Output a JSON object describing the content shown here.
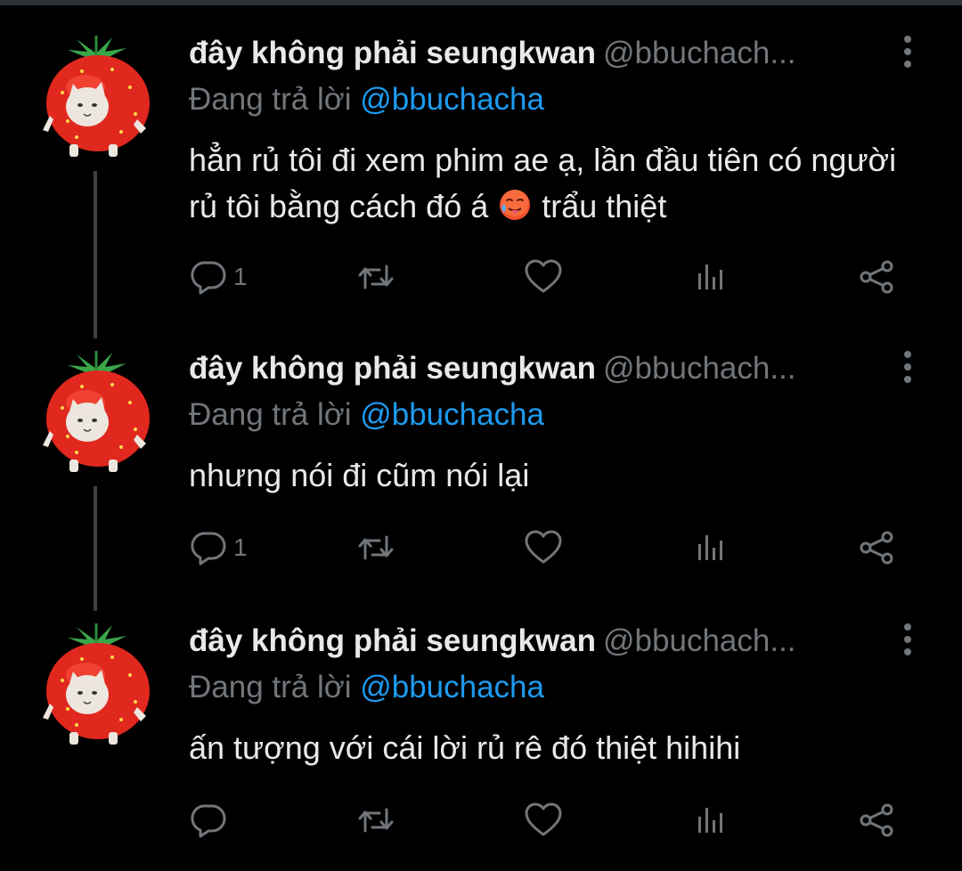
{
  "tweets": [
    {
      "author_name": "đây không phải seungkwan",
      "author_handle": "@bbuchach...",
      "replying_prefix": "Đang trả lời ",
      "replying_to": "@bbuchacha",
      "text_before_emoji": "hẳn rủ tôi đi xem phim ae ạ, lần đầu tiên có người rủ tôi bằng cách đó á ",
      "emoji": "hot-face-emoji",
      "text_after_emoji": " trẩu thiệt",
      "reply_count": "1"
    },
    {
      "author_name": "đây không phải seungkwan",
      "author_handle": "@bbuchach...",
      "replying_prefix": "Đang trả lời ",
      "replying_to": "@bbuchacha",
      "text": "nhưng nói đi cũm nói lại",
      "reply_count": "1"
    },
    {
      "author_name": "đây không phải seungkwan",
      "author_handle": "@bbuchach...",
      "replying_prefix": "Đang trả lời ",
      "replying_to": "@bbuchacha",
      "text": "ấn tượng với cái lời rủ rê đó thiệt hihihi",
      "reply_count": ""
    }
  ],
  "icons": {
    "reply": "reply-icon",
    "retweet": "retweet-icon",
    "like": "heart-icon",
    "analytics": "analytics-icon",
    "share": "share-icon",
    "more": "more-vertical-icon"
  },
  "colors": {
    "background": "#000000",
    "text": "#e7e9ea",
    "secondary": "#71767b",
    "link": "#1d9bf0",
    "thread_line": "#3e4144"
  }
}
